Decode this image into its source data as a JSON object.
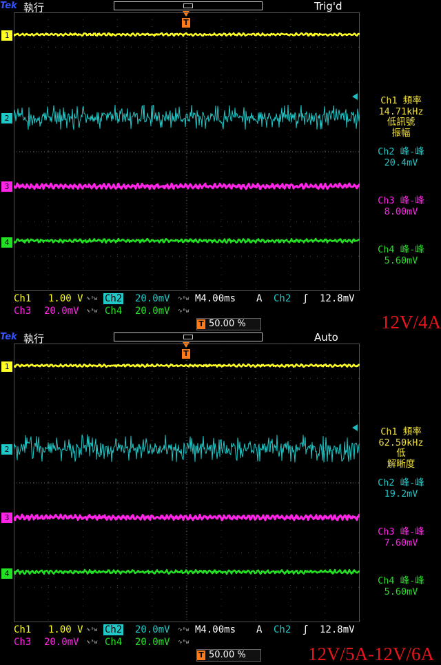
{
  "brand": "Tek",
  "colors": {
    "ch1": "#ffff24",
    "ch2": "#20c8c8",
    "ch3": "#ff24e8",
    "ch4": "#24e024",
    "trigger": "#ff7a1a",
    "caption": "#e8141b"
  },
  "icons": {
    "trigger_position": "trigger-t-icon",
    "bandwidth_limit": "bw-limit-icon",
    "rising_edge": "rising-edge-icon"
  },
  "screens": [
    {
      "mode": "執行",
      "trigger_status": "Trig'd",
      "channel_markers": [
        "1",
        "2",
        "3",
        "4"
      ],
      "measurements": {
        "ch1": {
          "label": "Ch1 頻率",
          "value": "14.71kHz",
          "note1": "低訊號",
          "note2": "振幅"
        },
        "ch2": {
          "label": "Ch2 峰-峰",
          "value": "20.4mV"
        },
        "ch3": {
          "label": "Ch3 峰-峰",
          "value": "8.00mV"
        },
        "ch4": {
          "label": "Ch4 峰-峰",
          "value": "5.60mV"
        }
      },
      "status": {
        "ch1_label": "Ch1",
        "ch1_scale": "1.00 V",
        "ch2_label": "Ch2",
        "ch2_scale": "20.0mV",
        "ch3_label": "Ch3",
        "ch3_scale": "20.0mV",
        "ch4_label": "Ch4",
        "ch4_scale": "20.0mV",
        "bw_symbol": "∿ᴮw",
        "timebase": "M4.00ms",
        "trigger_coupling": "A",
        "trigger_source": "Ch2",
        "trigger_slope": "ʃ",
        "trigger_level": "12.8mV",
        "trigger_position": "50.00 %"
      },
      "caption": "12V/4A"
    },
    {
      "mode": "執行",
      "trigger_status": "Auto",
      "channel_markers": [
        "1",
        "2",
        "3",
        "4"
      ],
      "measurements": {
        "ch1": {
          "label": "Ch1 頻率",
          "value": "62.50kHz",
          "note1": "低",
          "note2": "解晰度"
        },
        "ch2": {
          "label": "Ch2 峰-峰",
          "value": "19.2mV"
        },
        "ch3": {
          "label": "Ch3 峰-峰",
          "value": "7.60mV"
        },
        "ch4": {
          "label": "Ch4 峰-峰",
          "value": "5.60mV"
        }
      },
      "status": {
        "ch1_label": "Ch1",
        "ch1_scale": "1.00 V",
        "ch2_label": "Ch2",
        "ch2_scale": "20.0mV",
        "ch3_label": "Ch3",
        "ch3_scale": "20.0mV",
        "ch4_label": "Ch4",
        "ch4_scale": "20.0mV",
        "bw_symbol": "∿ᴮw",
        "timebase": "M4.00ms",
        "trigger_coupling": "A",
        "trigger_source": "Ch2",
        "trigger_slope": "ʃ",
        "trigger_level": "12.8mV",
        "trigger_position": "50.00 %"
      },
      "caption": "12V/5A-12V/6A"
    }
  ]
}
